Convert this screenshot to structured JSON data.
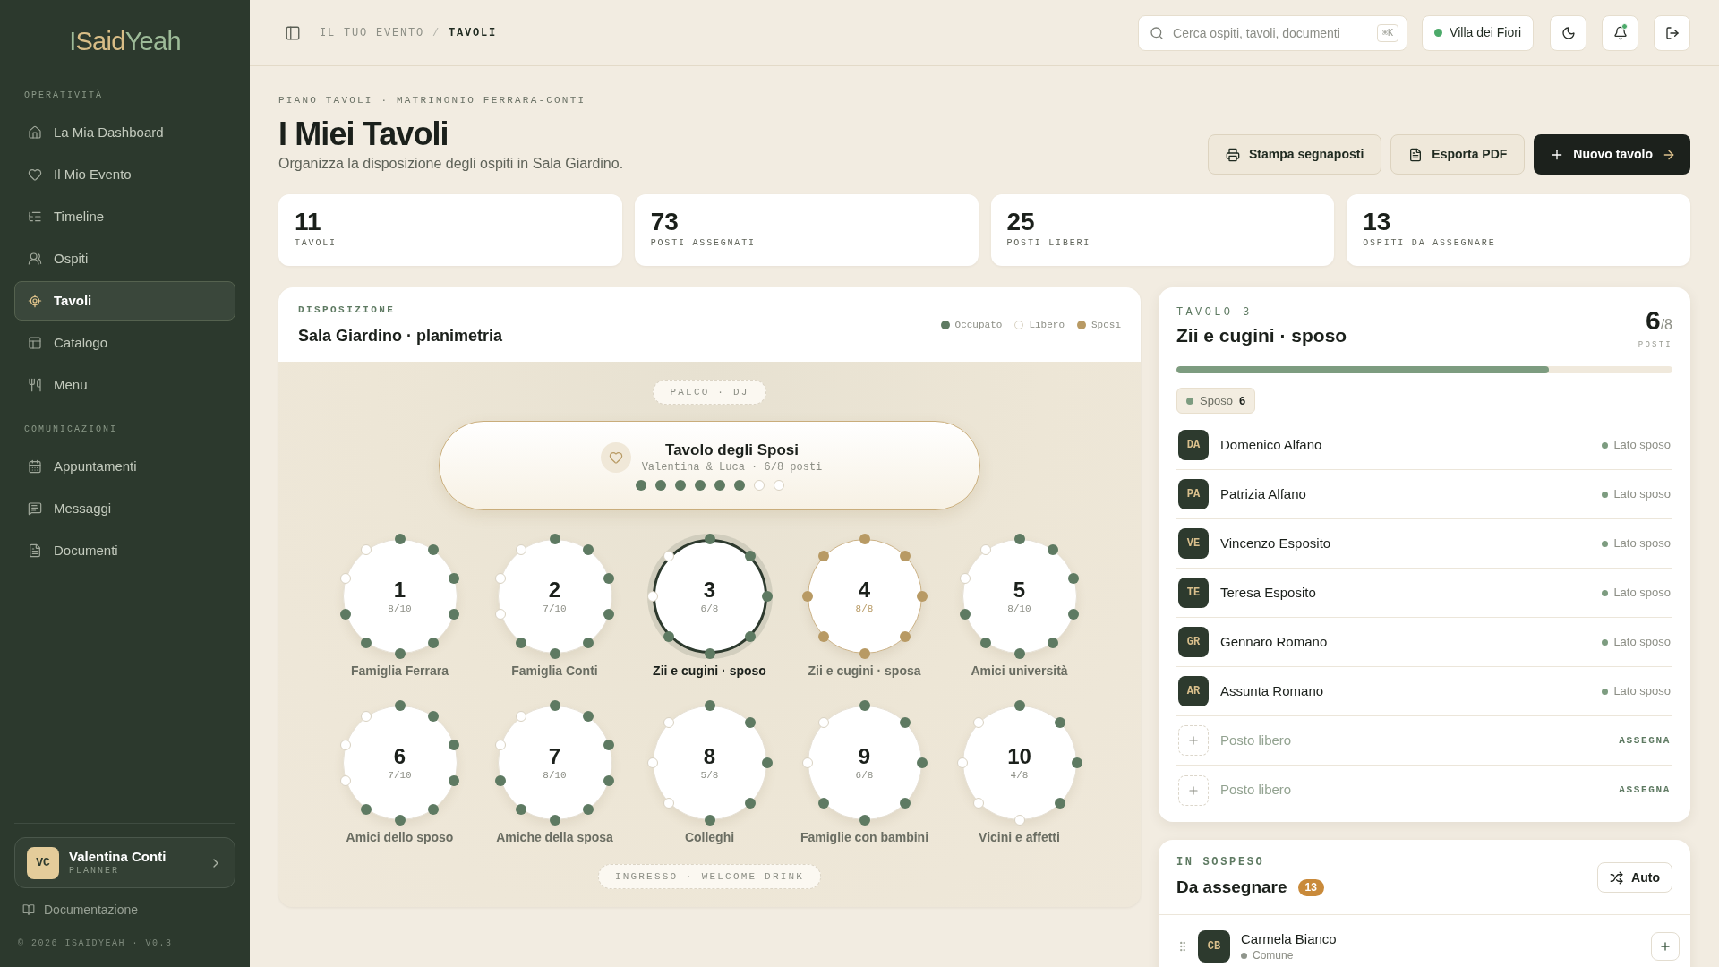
{
  "sidebar": {
    "logo": [
      "I",
      "Said",
      "Yeah"
    ],
    "sections": [
      {
        "title": "OPERATIVITÀ",
        "items": [
          {
            "label": "La Mia Dashboard",
            "selected": false
          },
          {
            "label": "Il Mio Evento",
            "selected": false
          },
          {
            "label": "Timeline",
            "selected": false
          },
          {
            "label": "Ospiti",
            "selected": false
          },
          {
            "label": "Tavoli",
            "selected": true
          },
          {
            "label": "Catalogo",
            "selected": false
          },
          {
            "label": "Menu",
            "selected": false
          }
        ]
      },
      {
        "title": "COMUNICAZIONI",
        "items": [
          {
            "label": "Appuntamenti",
            "selected": false
          },
          {
            "label": "Messaggi",
            "selected": false
          },
          {
            "label": "Documenti",
            "selected": false
          }
        ]
      }
    ],
    "user": {
      "initials": "VC",
      "name": "Valentina Conti",
      "role": "PLANNER"
    },
    "docs_link": "Documentazione",
    "footer": "© 2026 ISAIDYEAH · V0.3"
  },
  "topbar": {
    "breadcrumb": {
      "parent": "IL TUO EVENTO",
      "separator": "/",
      "current": "TAVOLI"
    },
    "search": {
      "placeholder": "Cerca ospiti, tavoli, documenti",
      "shortcut": "⌘K"
    },
    "venue": "Villa dei Fiori",
    "notifications": {
      "unread": true
    }
  },
  "header": {
    "eyebrow": "PIANO TAVOLI · MATRIMONIO FERRARA-CONTI",
    "title": "I Miei Tavoli",
    "subtitle": "Organizza la disposizione degli ospiti in Sala Giardino.",
    "actions": [
      {
        "label": "Stampa segnaposti",
        "kind": "outline"
      },
      {
        "label": "Esporta PDF",
        "kind": "outline"
      },
      {
        "label": "Nuovo tavolo",
        "kind": "primary"
      }
    ]
  },
  "stats": [
    {
      "value": "11",
      "label": "TAVOLI"
    },
    {
      "value": "73",
      "label": "POSTI ASSEGNATI"
    },
    {
      "value": "25",
      "label": "POSTI LIBERI"
    },
    {
      "value": "13",
      "label": "OSPITI DA ASSEGNARE"
    }
  ],
  "floor_plan": {
    "eyebrow": "DISPOSIZIONE",
    "title": "Sala Giardino · planimetria",
    "legend": [
      {
        "label": "Occupato",
        "kind": "occupied"
      },
      {
        "label": "Libero",
        "kind": "free"
      },
      {
        "label": "Sposi",
        "kind": "couple"
      }
    ],
    "stage": "PALCO · DJ",
    "head_table": {
      "title": "Tavolo degli Sposi",
      "subtitle": "Valentina & Luca · 6/8 posti",
      "seats": [
        {
          "kind": "occupied"
        },
        {
          "kind": "occupied"
        },
        {
          "kind": "occupied"
        },
        {
          "kind": "occupied"
        },
        {
          "kind": "occupied"
        },
        {
          "kind": "occupied"
        },
        {
          "kind": "free"
        },
        {
          "kind": "free"
        }
      ]
    },
    "tables": [
      {
        "number": "1",
        "count": "8/10",
        "name": "Famiglia Ferrara",
        "kind": "standard",
        "selected": false,
        "seats": [
          {
            "kind": "occupied"
          },
          {
            "kind": "occupied"
          },
          {
            "kind": "occupied"
          },
          {
            "kind": "occupied"
          },
          {
            "kind": "occupied"
          },
          {
            "kind": "occupied"
          },
          {
            "kind": "occupied"
          },
          {
            "kind": "occupied"
          },
          {
            "kind": "free"
          },
          {
            "kind": "free"
          }
        ]
      },
      {
        "number": "2",
        "count": "7/10",
        "name": "Famiglia Conti",
        "kind": "standard",
        "selected": false,
        "seats": [
          {
            "kind": "occupied"
          },
          {
            "kind": "occupied"
          },
          {
            "kind": "occupied"
          },
          {
            "kind": "occupied"
          },
          {
            "kind": "occupied"
          },
          {
            "kind": "occupied"
          },
          {
            "kind": "occupied"
          },
          {
            "kind": "free"
          },
          {
            "kind": "free"
          },
          {
            "kind": "free"
          }
        ]
      },
      {
        "number": "3",
        "count": "6/8",
        "name": "Zii e cugini · sposo",
        "kind": "standard",
        "selected": true,
        "seats": [
          {
            "kind": "occupied"
          },
          {
            "kind": "occupied"
          },
          {
            "kind": "occupied"
          },
          {
            "kind": "occupied"
          },
          {
            "kind": "occupied"
          },
          {
            "kind": "occupied"
          },
          {
            "kind": "free"
          },
          {
            "kind": "free"
          }
        ]
      },
      {
        "number": "4",
        "count": "8/8",
        "name": "Zii e cugini · sposa",
        "kind": "couple",
        "selected": false,
        "seats": [
          {
            "kind": "couple"
          },
          {
            "kind": "couple"
          },
          {
            "kind": "couple"
          },
          {
            "kind": "couple"
          },
          {
            "kind": "couple"
          },
          {
            "kind": "couple"
          },
          {
            "kind": "couple"
          },
          {
            "kind": "couple"
          }
        ]
      },
      {
        "number": "5",
        "count": "8/10",
        "name": "Amici università",
        "kind": "standard",
        "selected": false,
        "seats": [
          {
            "kind": "occupied"
          },
          {
            "kind": "occupied"
          },
          {
            "kind": "occupied"
          },
          {
            "kind": "occupied"
          },
          {
            "kind": "occupied"
          },
          {
            "kind": "occupied"
          },
          {
            "kind": "occupied"
          },
          {
            "kind": "occupied"
          },
          {
            "kind": "free"
          },
          {
            "kind": "free"
          }
        ]
      },
      {
        "number": "6",
        "count": "7/10",
        "name": "Amici dello sposo",
        "kind": "standard",
        "selected": false,
        "seats": [
          {
            "kind": "occupied"
          },
          {
            "kind": "occupied"
          },
          {
            "kind": "occupied"
          },
          {
            "kind": "occupied"
          },
          {
            "kind": "occupied"
          },
          {
            "kind": "occupied"
          },
          {
            "kind": "occupied"
          },
          {
            "kind": "free"
          },
          {
            "kind": "free"
          },
          {
            "kind": "free"
          }
        ]
      },
      {
        "number": "7",
        "count": "8/10",
        "name": "Amiche della sposa",
        "kind": "standard",
        "selected": false,
        "seats": [
          {
            "kind": "occupied"
          },
          {
            "kind": "occupied"
          },
          {
            "kind": "occupied"
          },
          {
            "kind": "occupied"
          },
          {
            "kind": "occupied"
          },
          {
            "kind": "occupied"
          },
          {
            "kind": "occupied"
          },
          {
            "kind": "occupied"
          },
          {
            "kind": "free"
          },
          {
            "kind": "free"
          }
        ]
      },
      {
        "number": "8",
        "count": "5/8",
        "name": "Colleghi",
        "kind": "standard",
        "selected": false,
        "seats": [
          {
            "kind": "occupied"
          },
          {
            "kind": "occupied"
          },
          {
            "kind": "occupied"
          },
          {
            "kind": "occupied"
          },
          {
            "kind": "occupied"
          },
          {
            "kind": "free"
          },
          {
            "kind": "free"
          },
          {
            "kind": "free"
          }
        ]
      },
      {
        "number": "9",
        "count": "6/8",
        "name": "Famiglie con bambini",
        "kind": "standard",
        "selected": false,
        "seats": [
          {
            "kind": "occupied"
          },
          {
            "kind": "occupied"
          },
          {
            "kind": "occupied"
          },
          {
            "kind": "occupied"
          },
          {
            "kind": "occupied"
          },
          {
            "kind": "occupied"
          },
          {
            "kind": "free"
          },
          {
            "kind": "free"
          }
        ]
      },
      {
        "number": "10",
        "count": "4/8",
        "name": "Vicini e affetti",
        "kind": "standard",
        "selected": false,
        "seats": [
          {
            "kind": "occupied"
          },
          {
            "kind": "occupied"
          },
          {
            "kind": "occupied"
          },
          {
            "kind": "occupied"
          },
          {
            "kind": "free"
          },
          {
            "kind": "free"
          },
          {
            "kind": "free"
          },
          {
            "kind": "free"
          }
        ]
      }
    ],
    "entrance": "INGRESSO · WELCOME DRINK"
  },
  "table_detail": {
    "eyebrow": "TAVOLO 3",
    "title": "Zii e cugini · sposo",
    "count": "6",
    "capacity": "/8",
    "count_label": "POSTI",
    "level": 0.75,
    "chips": [
      {
        "label": "Sposo",
        "count": "6",
        "color": "#7d9c80"
      }
    ],
    "rows": [
      {
        "kind": "guest",
        "initials": "DA",
        "name": "Domenico Alfano",
        "side": "Lato sposo",
        "color": "#7d9c80"
      },
      {
        "kind": "guest",
        "initials": "PA",
        "name": "Patrizia Alfano",
        "side": "Lato sposo",
        "color": "#7d9c80"
      },
      {
        "kind": "guest",
        "initials": "VE",
        "name": "Vincenzo Esposito",
        "side": "Lato sposo",
        "color": "#7d9c80"
      },
      {
        "kind": "guest",
        "initials": "TE",
        "name": "Teresa Esposito",
        "side": "Lato sposo",
        "color": "#7d9c80"
      },
      {
        "kind": "guest",
        "initials": "GR",
        "name": "Gennaro Romano",
        "side": "Lato sposo",
        "color": "#7d9c80"
      },
      {
        "kind": "guest",
        "initials": "AR",
        "name": "Assunta Romano",
        "side": "Lato sposo",
        "color": "#7d9c80"
      },
      {
        "kind": "free",
        "label": "Posto libero",
        "action": "ASSEGNA"
      },
      {
        "kind": "free",
        "label": "Posto libero",
        "action": "ASSEGNA"
      }
    ]
  },
  "pending": {
    "eyebrow": "IN SOSPESO",
    "title": "Da assegnare",
    "badge": "13",
    "action": "Auto",
    "guests": [
      {
        "initials": "CB",
        "name": "Carmela Bianco",
        "group": "Comune",
        "color": "#8f958c"
      }
    ]
  }
}
